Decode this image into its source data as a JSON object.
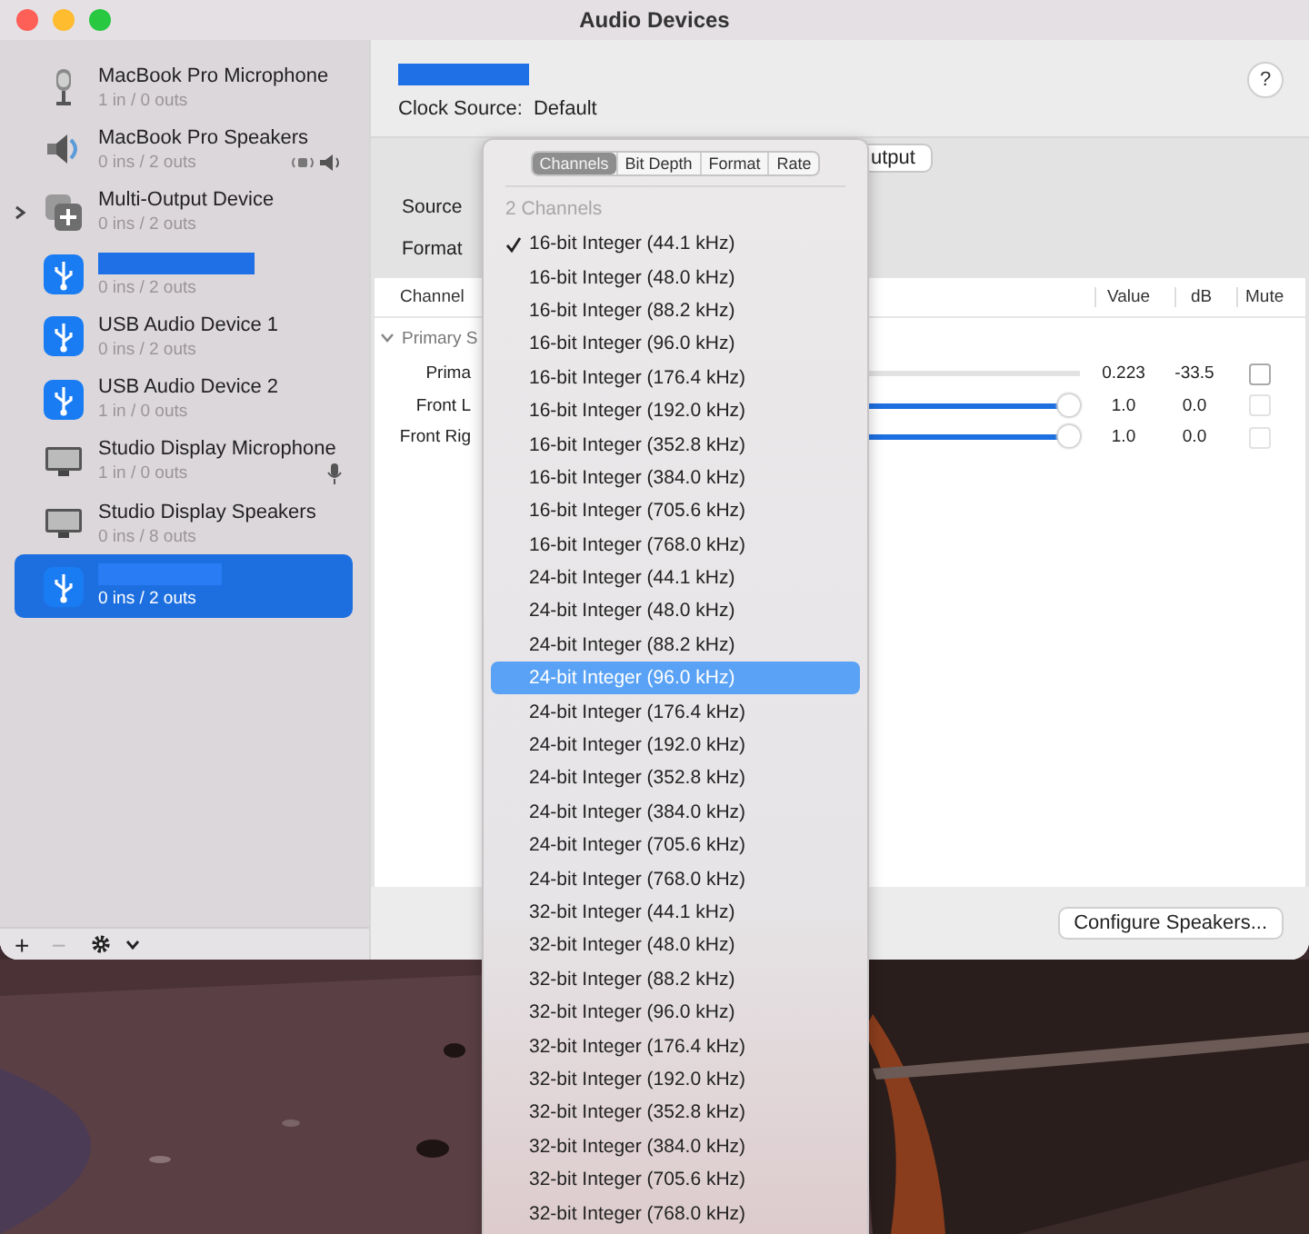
{
  "window": {
    "title": "Audio Devices"
  },
  "devices": [
    {
      "kind": "microphone",
      "name": "MacBook Pro Microphone",
      "name_hidden": false,
      "io": "1 in / 0 outs",
      "selected": false,
      "default_input": false,
      "default_output": false,
      "system_output": false
    },
    {
      "kind": "speaker",
      "name": "MacBook Pro Speakers",
      "name_hidden": false,
      "io": "0 ins / 2 outs",
      "selected": false,
      "default_input": false,
      "default_output": true,
      "system_output": true
    },
    {
      "kind": "aggregate",
      "name": "Multi-Output Device",
      "name_hidden": false,
      "io": "0 ins / 2 outs",
      "selected": false,
      "expanded": false,
      "default_input": false,
      "default_output": false,
      "system_output": false
    },
    {
      "kind": "usb",
      "name_hidden": true,
      "io": "0 ins / 2 outs",
      "selected": false,
      "default_input": false,
      "default_output": false,
      "system_output": false
    },
    {
      "kind": "usb",
      "name": "USB Audio Device 1",
      "name_hidden": false,
      "io": "0 ins / 2 outs",
      "selected": false,
      "default_input": false,
      "default_output": false,
      "system_output": false
    },
    {
      "kind": "usb",
      "name": "USB Audio Device 2",
      "name_hidden": false,
      "io": "1 in / 0 outs",
      "selected": false,
      "default_input": false,
      "default_output": false,
      "system_output": false
    },
    {
      "kind": "display",
      "name": "Studio Display Microphone",
      "name_hidden": false,
      "io": "1 in / 0 outs",
      "selected": false,
      "default_input": true,
      "default_output": false,
      "system_output": false
    },
    {
      "kind": "display",
      "name": "Studio Display Speakers",
      "name_hidden": false,
      "io": "0 ins / 8 outs",
      "selected": false,
      "default_input": false,
      "default_output": false,
      "system_output": false
    },
    {
      "kind": "usb",
      "name_hidden": true,
      "io": "0 ins / 2 outs",
      "selected": true,
      "default_input": false,
      "default_output": false,
      "system_output": false
    }
  ],
  "sidebar_toolbar": [
    {
      "label": "+",
      "disabled": false
    },
    {
      "label": "−",
      "disabled": true
    }
  ],
  "panel": {
    "name_hidden": true,
    "clock_label": "Clock Source:",
    "clock_value": "Default",
    "help": "?",
    "mode_segment": "utput",
    "source_label": "Source",
    "format_label": "Format",
    "table": {
      "columns": [
        "Channel",
        "Value",
        "dB",
        "Mute"
      ],
      "group": {
        "label": "Primary S",
        "expanded": true
      },
      "rows": [
        {
          "name": "Prima",
          "value": "0.223",
          "db": "-33.5",
          "muted": false,
          "disabled": false
        },
        {
          "name": "Front L",
          "level": 1.0,
          "value": "1.0",
          "db": "0.0",
          "muted": false,
          "disabled": true
        },
        {
          "name": "Front Rig",
          "level": 1.0,
          "value": "1.0",
          "db": "0.0",
          "muted": false,
          "disabled": true
        }
      ]
    },
    "configure_button": "Configure Speakers..."
  },
  "format_menu": {
    "tabs": [
      {
        "label": "Channels",
        "selected": true
      },
      {
        "label": "Bit Depth",
        "selected": false
      },
      {
        "label": "Format",
        "selected": false
      },
      {
        "label": "Rate",
        "selected": false
      }
    ],
    "section": "2 Channels",
    "items": [
      {
        "label": "16-bit Integer (44.1 kHz)",
        "checked": true,
        "highlighted": false
      },
      {
        "label": "16-bit Integer (48.0 kHz)",
        "checked": false,
        "highlighted": false
      },
      {
        "label": "16-bit Integer (88.2 kHz)",
        "checked": false,
        "highlighted": false
      },
      {
        "label": "16-bit Integer (96.0 kHz)",
        "checked": false,
        "highlighted": false
      },
      {
        "label": "16-bit Integer (176.4 kHz)",
        "checked": false,
        "highlighted": false
      },
      {
        "label": "16-bit Integer (192.0 kHz)",
        "checked": false,
        "highlighted": false
      },
      {
        "label": "16-bit Integer (352.8 kHz)",
        "checked": false,
        "highlighted": false
      },
      {
        "label": "16-bit Integer (384.0 kHz)",
        "checked": false,
        "highlighted": false
      },
      {
        "label": "16-bit Integer (705.6 kHz)",
        "checked": false,
        "highlighted": false
      },
      {
        "label": "16-bit Integer (768.0 kHz)",
        "checked": false,
        "highlighted": false
      },
      {
        "label": "24-bit Integer (44.1 kHz)",
        "checked": false,
        "highlighted": false
      },
      {
        "label": "24-bit Integer (48.0 kHz)",
        "checked": false,
        "highlighted": false
      },
      {
        "label": "24-bit Integer (88.2 kHz)",
        "checked": false,
        "highlighted": false
      },
      {
        "label": "24-bit Integer (96.0 kHz)",
        "checked": false,
        "highlighted": true
      },
      {
        "label": "24-bit Integer (176.4 kHz)",
        "checked": false,
        "highlighted": false
      },
      {
        "label": "24-bit Integer (192.0 kHz)",
        "checked": false,
        "highlighted": false
      },
      {
        "label": "24-bit Integer (352.8 kHz)",
        "checked": false,
        "highlighted": false
      },
      {
        "label": "24-bit Integer (384.0 kHz)",
        "checked": false,
        "highlighted": false
      },
      {
        "label": "24-bit Integer (705.6 kHz)",
        "checked": false,
        "highlighted": false
      },
      {
        "label": "24-bit Integer (768.0 kHz)",
        "checked": false,
        "highlighted": false
      },
      {
        "label": "32-bit Integer (44.1 kHz)",
        "checked": false,
        "highlighted": false
      },
      {
        "label": "32-bit Integer (48.0 kHz)",
        "checked": false,
        "highlighted": false
      },
      {
        "label": "32-bit Integer (88.2 kHz)",
        "checked": false,
        "highlighted": false
      },
      {
        "label": "32-bit Integer (96.0 kHz)",
        "checked": false,
        "highlighted": false
      },
      {
        "label": "32-bit Integer (176.4 kHz)",
        "checked": false,
        "highlighted": false
      },
      {
        "label": "32-bit Integer (192.0 kHz)",
        "checked": false,
        "highlighted": false
      },
      {
        "label": "32-bit Integer (352.8 kHz)",
        "checked": false,
        "highlighted": false
      },
      {
        "label": "32-bit Integer (384.0 kHz)",
        "checked": false,
        "highlighted": false
      },
      {
        "label": "32-bit Integer (705.6 kHz)",
        "checked": false,
        "highlighted": false
      },
      {
        "label": "32-bit Integer (768.0 kHz)",
        "checked": false,
        "highlighted": false
      }
    ]
  }
}
